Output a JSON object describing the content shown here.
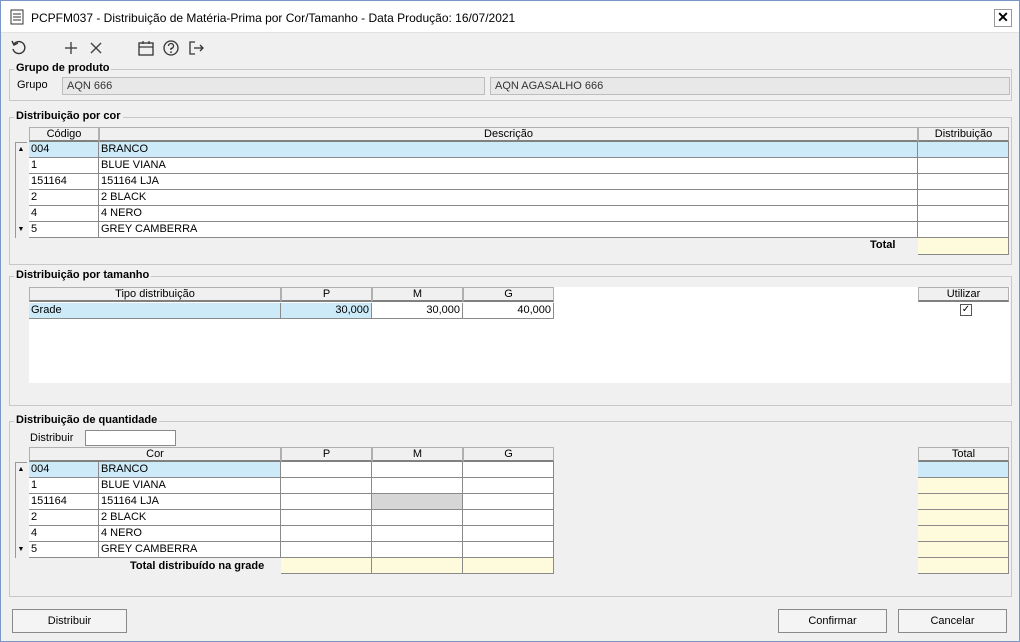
{
  "window": {
    "title": "PCPFM037 - Distribuição de Matéria-Prima por Cor/Tamanho - Data Produção: 16/07/2021",
    "close_label": "✕"
  },
  "toolbar": {
    "icons": [
      "refresh-icon",
      "add-icon",
      "delete-icon",
      "calendar-icon",
      "help-icon",
      "exit-icon"
    ]
  },
  "grupo_produto": {
    "legend": "Grupo de produto",
    "label": "Grupo",
    "code": "AQN 666",
    "description": "AQN AGASALHO 666"
  },
  "dist_cor": {
    "legend": "Distribuição por cor",
    "headers": {
      "codigo": "Código",
      "descricao": "Descrição",
      "distribuicao": "Distribuição"
    },
    "rows": [
      {
        "codigo": "004",
        "descricao": "BRANCO",
        "distribuicao": ""
      },
      {
        "codigo": "1",
        "descricao": "BLUE VIANA",
        "distribuicao": ""
      },
      {
        "codigo": "151164",
        "descricao": "151164 LJA",
        "distribuicao": ""
      },
      {
        "codigo": "2",
        "descricao": "2 BLACK",
        "distribuicao": ""
      },
      {
        "codigo": "4",
        "descricao": "4 NERO",
        "distribuicao": ""
      },
      {
        "codigo": "5",
        "descricao": "GREY CAMBERRA",
        "distribuicao": ""
      }
    ],
    "total_label": "Total",
    "total_value": ""
  },
  "dist_tamanho": {
    "legend": "Distribuição por tamanho",
    "headers": {
      "tipo": "Tipo distribuição",
      "p": "P",
      "m": "M",
      "g": "G",
      "utilizar": "Utilizar"
    },
    "row": {
      "tipo": "Grade",
      "p": "30,000",
      "m": "30,000",
      "g": "40,000",
      "utilizar": true
    }
  },
  "dist_quantidade": {
    "legend": "Distribuição de quantidade",
    "distribuir_label": "Distribuir",
    "distribuir_value": "",
    "headers": {
      "cor": "Cor",
      "p": "P",
      "m": "M",
      "g": "G",
      "total": "Total"
    },
    "rows": [
      {
        "codigo": "004",
        "descricao": "BRANCO"
      },
      {
        "codigo": "1",
        "descricao": "BLUE VIANA"
      },
      {
        "codigo": "151164",
        "descricao": "151164 LJA"
      },
      {
        "codigo": "2",
        "descricao": "2 BLACK"
      },
      {
        "codigo": "4",
        "descricao": "4 NERO"
      },
      {
        "codigo": "5",
        "descricao": "GREY CAMBERRA"
      }
    ],
    "total_label": "Total distribuído na grade"
  },
  "buttons": {
    "distribuir": "Distribuir",
    "confirmar": "Confirmar",
    "cancelar": "Cancelar"
  },
  "colors": {
    "selected_row": "#cdeaf8",
    "total_cell": "#fdfbdc",
    "window_bg": "#f0f0f0"
  }
}
